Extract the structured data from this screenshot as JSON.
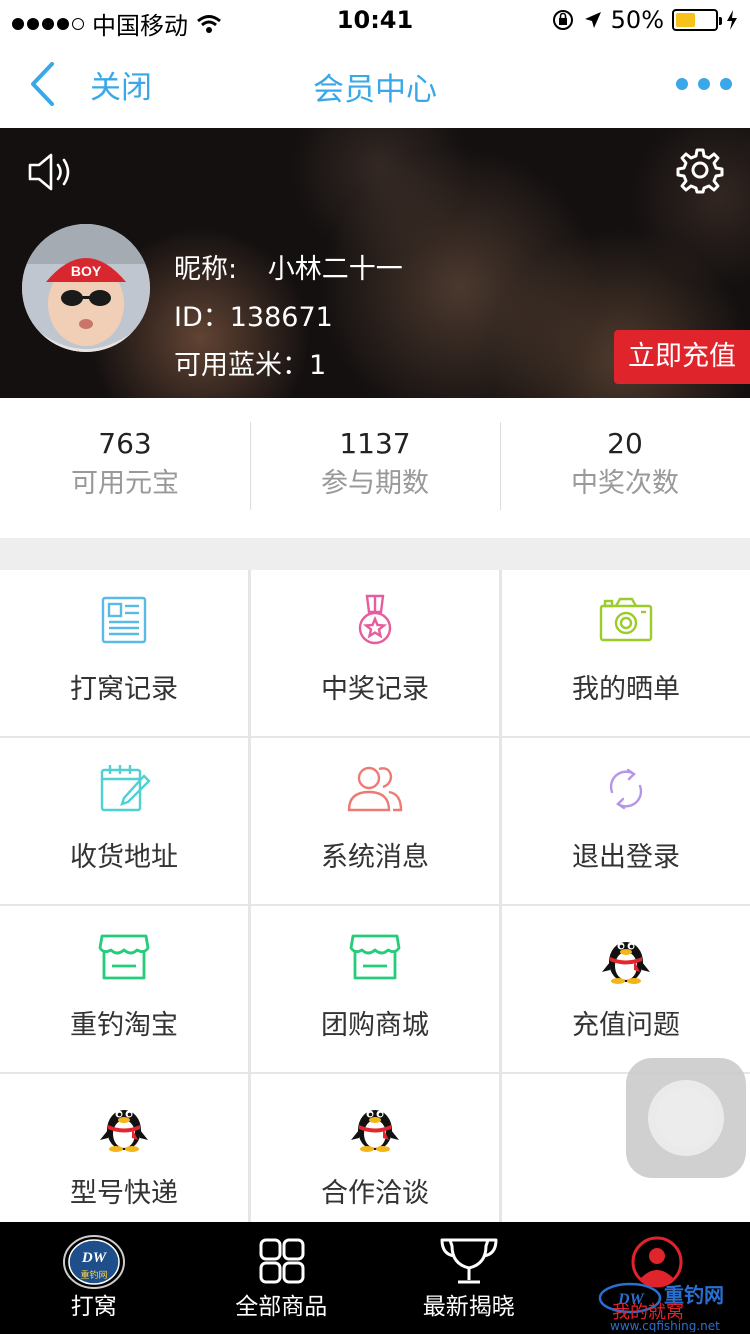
{
  "status_bar": {
    "carrier": "中国移动",
    "time": "10:41",
    "battery_percent": "50%",
    "battery_level": 0.5,
    "signal_bars_filled": 4,
    "signal_bars_total": 5
  },
  "nav": {
    "back_label": "关闭",
    "title": "会员中心",
    "accent_color": "#3aa8e8"
  },
  "profile": {
    "nickname_label": "昵称:",
    "nickname": "小林二十一",
    "id_text": "ID：138671",
    "points_text": "可用蓝米：1",
    "recharge_label": "立即充值",
    "recharge_color": "#e0242c",
    "avatar_hat_text": "BOY"
  },
  "stats": [
    {
      "value": "763",
      "label": "可用元宝"
    },
    {
      "value": "1137",
      "label": "参与期数"
    },
    {
      "value": "20",
      "label": "中奖次数"
    }
  ],
  "menu": [
    {
      "label": "打窝记录",
      "icon": "document-icon"
    },
    {
      "label": "中奖记录",
      "icon": "medal-icon"
    },
    {
      "label": "我的晒单",
      "icon": "camera-icon"
    },
    {
      "label": "收货地址",
      "icon": "notepad-pen-icon"
    },
    {
      "label": "系统消息",
      "icon": "users-icon"
    },
    {
      "label": "退出登录",
      "icon": "refresh-icon"
    },
    {
      "label": "重钓淘宝",
      "icon": "store-icon"
    },
    {
      "label": "团购商城",
      "icon": "store-icon"
    },
    {
      "label": "充值问题",
      "icon": "qq-penguin-icon"
    },
    {
      "label": "型号快递",
      "icon": "qq-penguin-icon"
    },
    {
      "label": "合作洽谈",
      "icon": "qq-penguin-icon"
    }
  ],
  "tabs": [
    {
      "label": "打窝",
      "icon": "dw-logo-icon",
      "logo_text": "重钓网"
    },
    {
      "label": "全部商品",
      "icon": "grid-icon"
    },
    {
      "label": "最新揭晓",
      "icon": "trophy-icon"
    },
    {
      "label": "",
      "icon": "user-profile-icon"
    }
  ],
  "watermark": {
    "line1": "重钓网",
    "line2": "我的就窝",
    "line3": "www.cqfishing.net"
  }
}
